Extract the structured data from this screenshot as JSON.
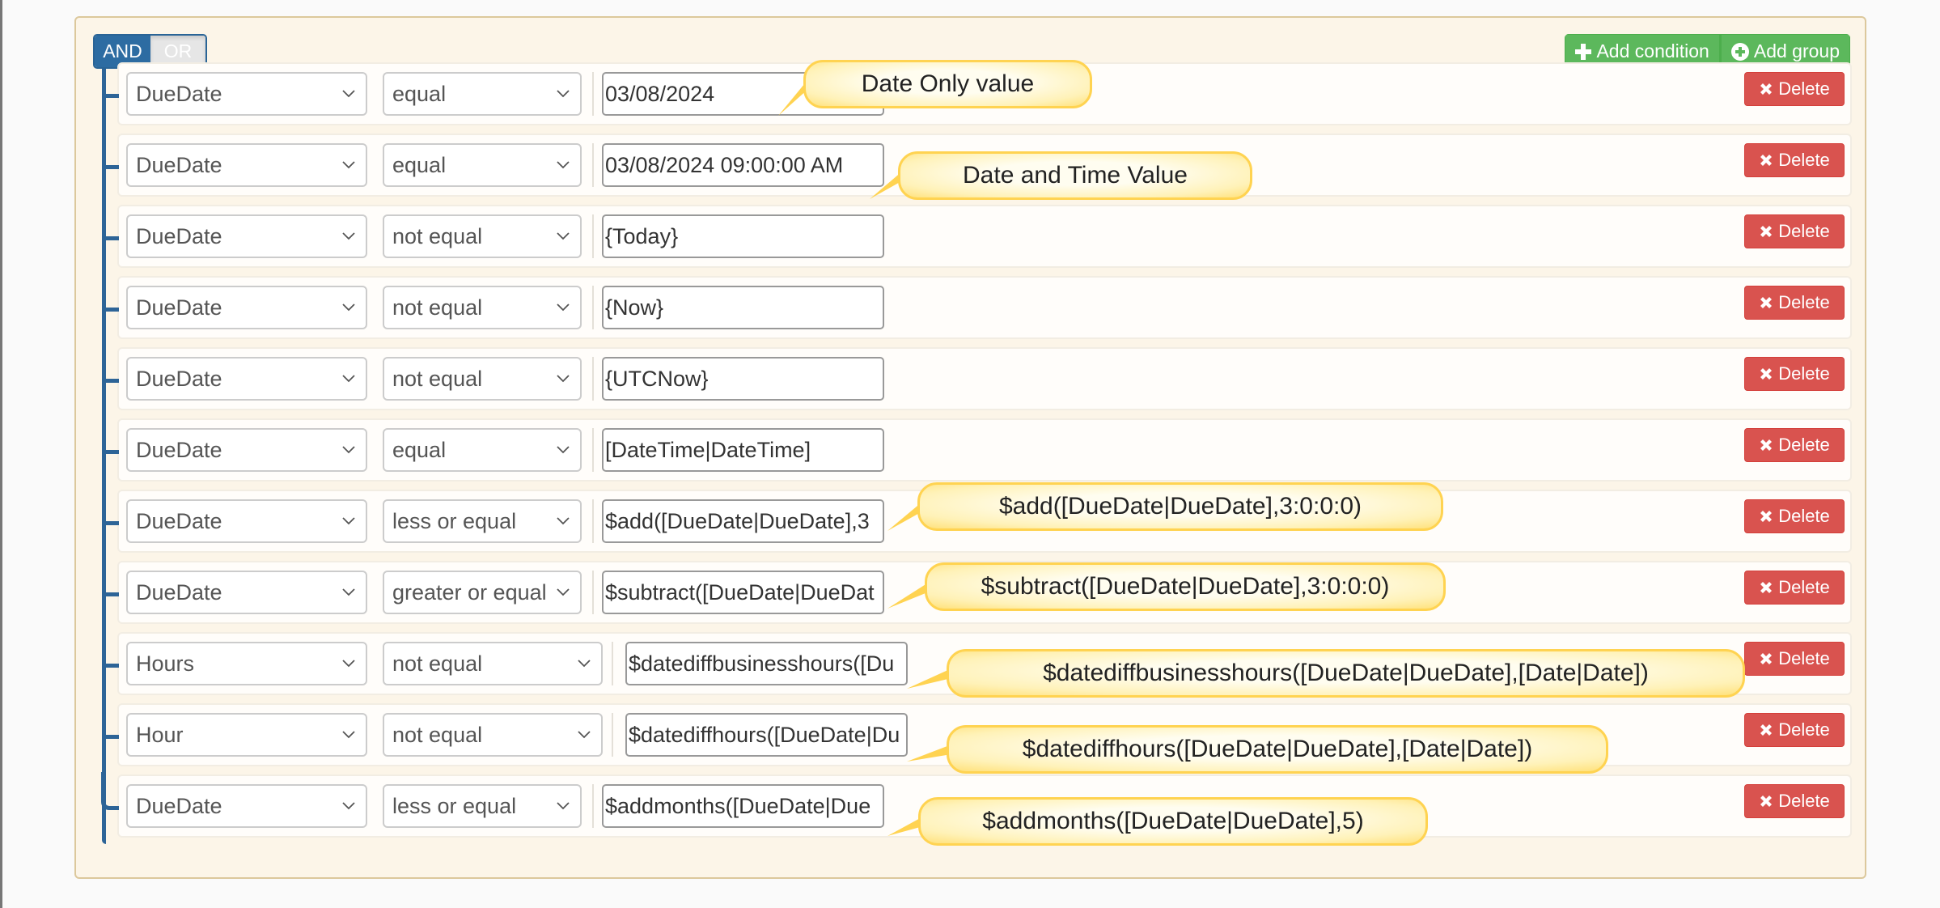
{
  "group": {
    "conjunction": {
      "and_label": "AND",
      "or_label": "OR",
      "selected": "AND"
    },
    "add_condition_label": "Add condition",
    "add_group_label": "Add group"
  },
  "rules": [
    {
      "field": "DueDate",
      "operator": "equal",
      "value": "03/08/2024",
      "delete_label": "Delete"
    },
    {
      "field": "DueDate",
      "operator": "equal",
      "value": "03/08/2024 09:00:00 AM",
      "delete_label": "Delete"
    },
    {
      "field": "DueDate",
      "operator": "not equal",
      "value": "{Today}",
      "delete_label": "Delete"
    },
    {
      "field": "DueDate",
      "operator": "not equal",
      "value": "{Now}",
      "delete_label": "Delete"
    },
    {
      "field": "DueDate",
      "operator": "not equal",
      "value": "{UTCNow}",
      "delete_label": "Delete"
    },
    {
      "field": "DueDate",
      "operator": "equal",
      "value": "[DateTime|DateTime]",
      "delete_label": "Delete"
    },
    {
      "field": "DueDate",
      "operator": "less or equal",
      "value": "$add([DueDate|DueDate],3",
      "delete_label": "Delete"
    },
    {
      "field": "DueDate",
      "operator": "greater or equal",
      "value": "$subtract([DueDate|DueDat",
      "delete_label": "Delete"
    },
    {
      "field": "Hours",
      "operator": "not equal",
      "value": "$datediffbusinesshours([Du",
      "delete_label": "Delete"
    },
    {
      "field": "Hour",
      "operator": "not equal",
      "value": "$datediffhours([DueDate|Du",
      "delete_label": "Delete"
    },
    {
      "field": "DueDate",
      "operator": "less or equal",
      "value": "$addmonths([DueDate|Due",
      "delete_label": "Delete"
    }
  ],
  "callouts": [
    {
      "text": "Date Only value",
      "rule_index": 0
    },
    {
      "text": "Date and Time Value",
      "rule_index": 1
    },
    {
      "text": "$add([DueDate|DueDate],3:0:0:0)",
      "rule_index": 6
    },
    {
      "text": "$subtract([DueDate|DueDate],3:0:0:0)",
      "rule_index": 7
    },
    {
      "text": "$datediffbusinesshours([DueDate|DueDate],[Date|Date])",
      "rule_index": 8
    },
    {
      "text": "$datediffhours([DueDate|DueDate],[Date|Date])",
      "rule_index": 9
    },
    {
      "text": "$addmonths([DueDate|DueDate],5)",
      "rule_index": 10
    }
  ],
  "icons": {
    "add_condition": "plus-icon",
    "add_group": "plus-circle-icon",
    "delete": "x-icon",
    "select": "chevron-down-icon"
  },
  "colors": {
    "primary": "#2d6ca2",
    "success": "#5cb85c",
    "danger": "#d9534f",
    "group_bg": "#fcf5e8",
    "callout_border": "#ffd351"
  }
}
